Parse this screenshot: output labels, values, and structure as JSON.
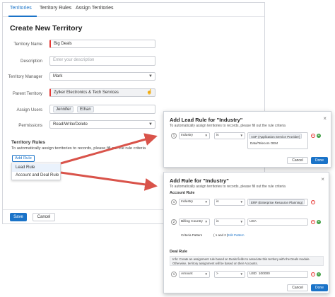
{
  "tabs": [
    {
      "label": "Territories",
      "active": true
    },
    {
      "label": "Territory Rules",
      "active": false
    },
    {
      "label": "Assign Territories",
      "active": false
    }
  ],
  "page_title": "Create New Territory",
  "form": {
    "territory_name": {
      "label": "Territory Name",
      "value": "Big Deals"
    },
    "description": {
      "label": "Description",
      "placeholder": "Enter your description"
    },
    "territory_manager": {
      "label": "Territory Manager",
      "value": "Mark"
    },
    "parent_territory": {
      "label": "Parent Territory",
      "value": "Zylker Electronics & Tech Services"
    },
    "assign_users": {
      "label": "Assign Users",
      "users": [
        "Jennifer",
        "Ethan"
      ]
    },
    "permissions": {
      "label": "Permissions",
      "value": "Read/Write/Delete"
    }
  },
  "territory_rules": {
    "title": "Territory Rules",
    "description": "To automatically assign territories to records, please fill out the rule criteria",
    "add_rule_label": "Add Rule",
    "menu": [
      "Lead Rule",
      "Account and Deal Rule"
    ]
  },
  "footer": {
    "save": "Save",
    "cancel": "Cancel"
  },
  "lead_dialog": {
    "title": "Add Lead Rule for \"Industry\"",
    "description": "To automatically assign territories to records, please fill out the rule criteria",
    "row": {
      "num": "1",
      "field": "Industry",
      "operator": "is",
      "values": [
        "ASP (Application Service Provider)",
        "Data/Telecom OEM"
      ]
    },
    "cancel": "Cancel",
    "done": "Done"
  },
  "account_dialog": {
    "title": "Add Rule for \"Industry\"",
    "description": "To automatically assign territories to records, please fill out the rule criteria",
    "account_rule_label": "Account Rule",
    "rows": [
      {
        "num": "1",
        "field": "Industry",
        "operator": "is",
        "value": "ERP (Enterprise Resource Planning)"
      },
      {
        "num": "2",
        "field": "Billing Country",
        "operator": "is",
        "value": "USA"
      }
    ],
    "criteria_pattern_label": "Criteria Pattern",
    "criteria_pattern": "( 1 and 2 )",
    "edit_pattern": "Edit Pattern",
    "deal_rule_label": "Deal Rule",
    "info_text": "Info: Create an assignment rule based on Deals fields to associate this territory with the Deals module. Otherwise, territory assignment will be based on their Accounts.",
    "deal_row": {
      "num": "1",
      "field": "Amount",
      "operator": ">",
      "currency": "USD",
      "value": "100000"
    },
    "cancel": "Cancel",
    "done": "Done"
  },
  "colors": {
    "accent": "#1a73c8",
    "arrow": "#d9534a",
    "required": "#e53935",
    "add": "#43a047"
  }
}
